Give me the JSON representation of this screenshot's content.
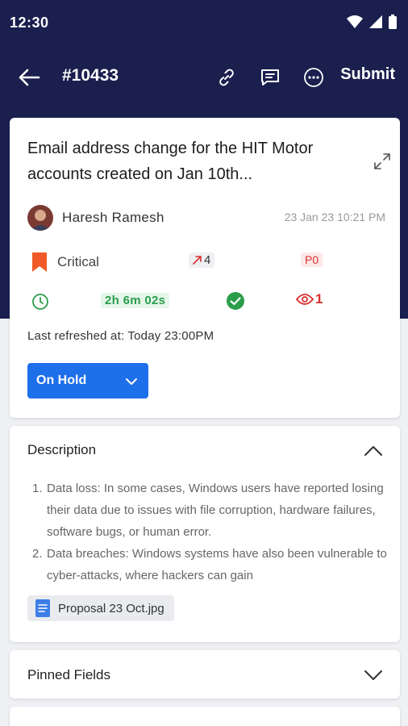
{
  "status_bar": {
    "time": "12:30"
  },
  "appbar": {
    "ticket_id": "#10433",
    "submit_label": "Submit"
  },
  "ticket": {
    "title": "Email address change for the HIT Motor accounts created on Jan 10th...",
    "assignee": "Haresh Ramesh",
    "created": "23 Jan 23 10:21 PM",
    "priority_label": "Critical",
    "escalations": "4",
    "priority_code": "P0",
    "sla_time": "2h 6m 02s",
    "watchers": "1",
    "last_refreshed": "Last refreshed at: Today 23:00PM",
    "status": "On Hold"
  },
  "description": {
    "title": "Description",
    "items": [
      {
        "num": "1.",
        "text": "Data loss: In some cases, Windows users have reported losing their data due to issues with file corruption, hardware failures, software bugs, or human error."
      },
      {
        "num": "2.",
        "text": "Data breaches: Windows systems have also been vulnerable to cyber-attacks, where hackers can gain"
      }
    ],
    "attachment": "Proposal 23 Oct.jpg"
  },
  "pinned_fields": {
    "title": "Pinned Fields"
  },
  "colors": {
    "header_bg": "#1a1f4e",
    "accent": "#1e6fea",
    "critical": "#f05a28",
    "sla_green": "#2a9d4b",
    "danger": "#d93030"
  }
}
